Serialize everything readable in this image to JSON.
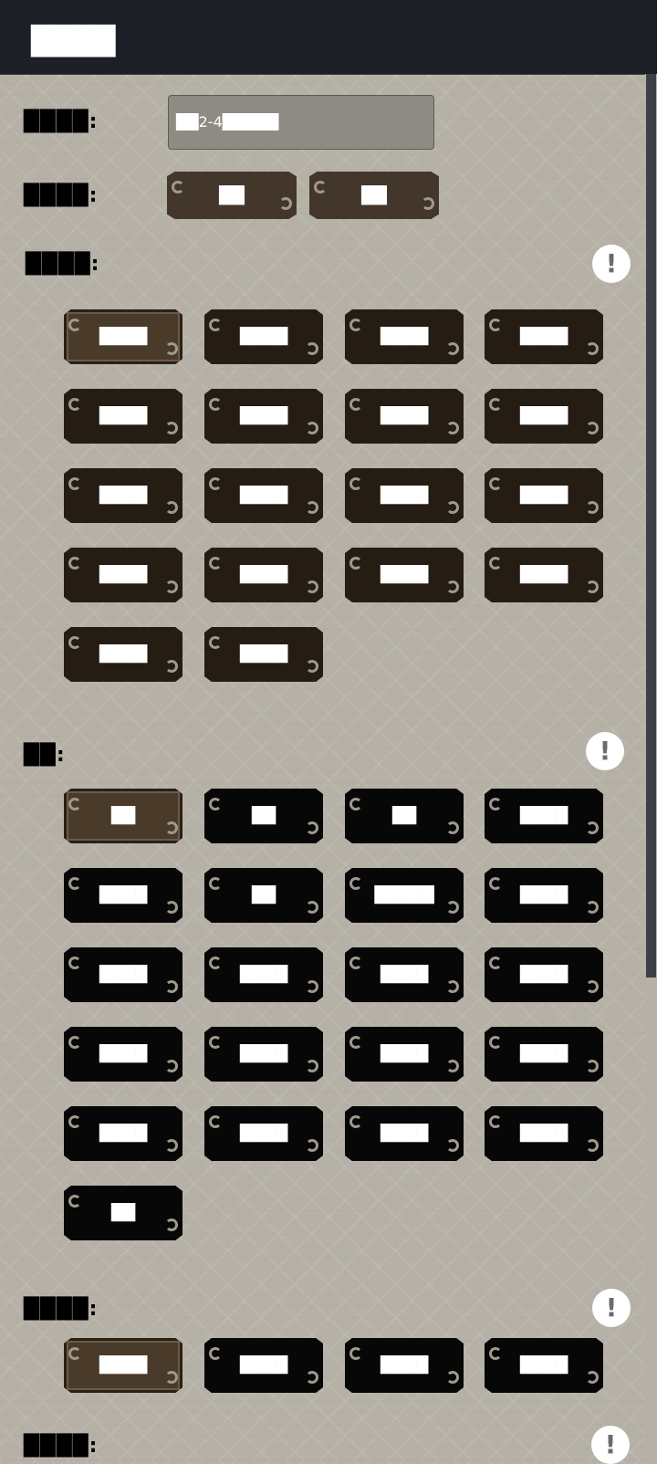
{
  "header": {
    "title": "████"
  },
  "form": {
    "field_label": "████:",
    "field_value": "██2-4█████",
    "toggle_label": "████:",
    "toggle_buttons": [
      "██",
      "██"
    ]
  },
  "sections": [
    {
      "label": "████:",
      "info_icon": "exclamation-icon",
      "buttons": [
        "████",
        "████",
        "████",
        "████",
        "████",
        "████",
        "████",
        "████",
        "████",
        "████",
        "████",
        "████",
        "████",
        "████",
        "████",
        "████",
        "████",
        "████"
      ],
      "selected": 0
    },
    {
      "label": "██:",
      "info_icon": "exclamation-icon",
      "buttons": [
        "██",
        "██",
        "██",
        "████",
        "████",
        "██",
        "█████",
        "████",
        "████",
        "████",
        "████",
        "████",
        "████",
        "████",
        "████",
        "████",
        "████",
        "████",
        "████",
        "████",
        "██"
      ],
      "selected": 0
    },
    {
      "label": "████:",
      "info_icon": "exclamation-icon",
      "buttons": [
        "████",
        "████",
        "████",
        "████"
      ],
      "selected": 0
    },
    {
      "label": "████:",
      "info_icon": "exclamation-icon",
      "buttons": [],
      "selected": null
    }
  ],
  "colors": {
    "header_bg": "#1c1f25",
    "page_bg": "#b6b1a6",
    "button_dark": "#251c13",
    "button_black": "#070707",
    "button_selected": "#4a3a2a"
  }
}
